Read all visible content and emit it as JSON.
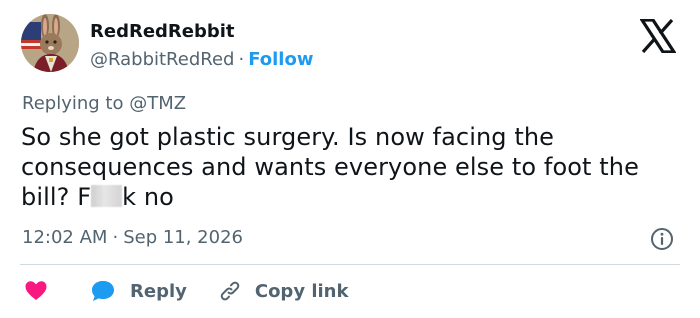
{
  "author": {
    "display_name": "RedRedRebbit",
    "handle": "@RabbitRedRed",
    "separator": "·",
    "follow_label": "Follow",
    "avatar_icon": "rabbit-portrait-avatar"
  },
  "logo_icon": "x-logo-icon",
  "reply_context": {
    "prefix": "Replying to",
    "mention": "@TMZ"
  },
  "tweet": {
    "text_main": "So she got plastic surgery. Is now facing the consequences and wants everyone else to foot the bill? F",
    "text_censored": "[censored]",
    "text_end": "k no"
  },
  "meta": {
    "time": "12:02 AM",
    "separator": "·",
    "date": "Sep 11, 2026"
  },
  "actions": {
    "like_icon": "heart-icon",
    "reply_label": "Reply",
    "reply_icon": "speech-bubble-icon",
    "copy_label": "Copy link",
    "copy_icon": "link-icon"
  },
  "colors": {
    "accent": "#1d9bf0",
    "like": "#f91880",
    "text_primary": "#0f1419",
    "text_secondary": "#536471",
    "divider": "#cfd9de"
  }
}
